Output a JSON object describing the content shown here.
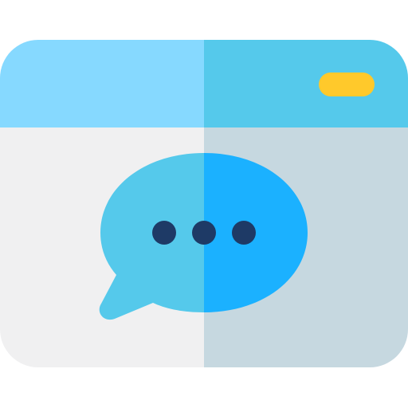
{
  "icon": {
    "name": "browser-chat-icon",
    "colors": {
      "titlebar_left": "#86D9FF",
      "titlebar_right": "#55C9EB",
      "body_left": "#F0F0F1",
      "body_right": "#C6D8E0",
      "bubble_left": "#55C9EB",
      "bubble_right": "#1BB1FF",
      "dots": "#1E3A66",
      "indicator": "#FFC92B"
    }
  }
}
